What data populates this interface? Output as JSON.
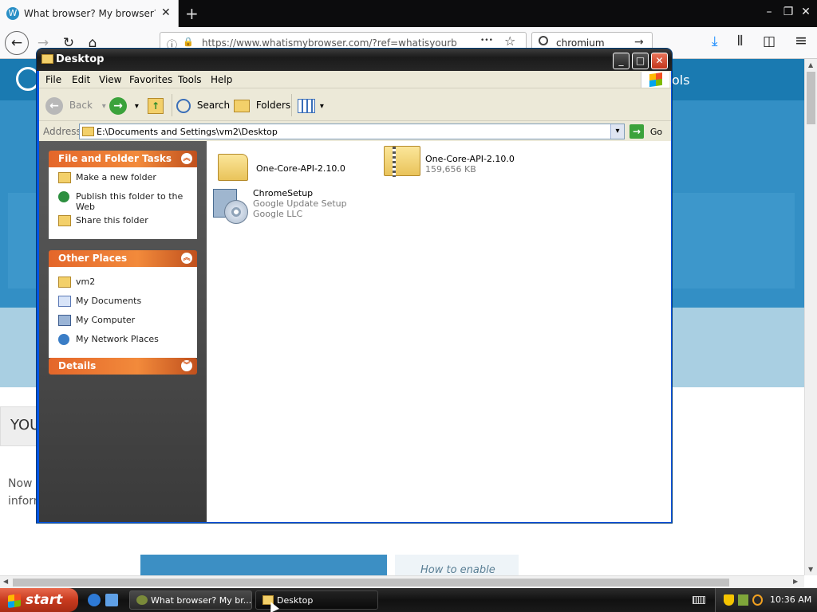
{
  "firefox": {
    "tab_title": "What browser? My browser? Is my",
    "tab_favicon": "W",
    "tab_close": "✕",
    "new_tab": "+",
    "window_buttons": {
      "minimize": "–",
      "restore": "❐",
      "close": "✕"
    },
    "nav": {
      "back": "←",
      "forward": "→",
      "reload": "↻",
      "home": "⌂"
    },
    "url": "https://www.whatismybrowser.com/?ref=whatisyourb",
    "url_icons": {
      "info": "ⓘ",
      "lock": "🔒",
      "more": "•••",
      "star": "☆"
    },
    "search_value": "chromium",
    "search_go": "→",
    "toolbar_icons": {
      "download": "⤓",
      "library": "⫴",
      "sidebar": "◫",
      "menu": "≡"
    },
    "colors": {
      "site_header": "#1a7ab1",
      "site_hero": "#338fc5"
    }
  },
  "website": {
    "tools_fragment": "ols",
    "you_fragment": "YOU",
    "now_fragment_1": "Now",
    "now_fragment_2": "inform",
    "howto_fragment": "How to enable"
  },
  "explorer": {
    "title": "Desktop",
    "caption_buttons": {
      "minimize": "_",
      "maximize": "□",
      "close": "✕"
    },
    "menu": [
      "File",
      "Edit",
      "View",
      "Favorites",
      "Tools",
      "Help"
    ],
    "toolbar": {
      "back_label": "Back",
      "back_icon": "←",
      "forward_icon": "→",
      "dropdown": "▾",
      "up_icon": "↑",
      "search_label": "Search",
      "folders_label": "Folders"
    },
    "address": {
      "label": "Address",
      "value": "E:\\Documents and Settings\\vm2\\Desktop",
      "dropdown": "▾",
      "go_label": "Go",
      "go_icon": "→"
    },
    "panels": {
      "file_tasks": {
        "title": "File and Folder Tasks",
        "chevron": "︽",
        "items": [
          "Make a new folder",
          "Publish this folder to the Web",
          "Share this folder"
        ]
      },
      "other_places": {
        "title": "Other Places",
        "chevron": "︽",
        "items": [
          "vm2",
          "My Documents",
          "My Computer",
          "My Network Places"
        ]
      },
      "details": {
        "title": "Details",
        "chevron": "︾"
      }
    },
    "files": [
      {
        "name": "One-Core-API-2.10.0",
        "type": "folder"
      },
      {
        "name": "One-Core-API-2.10.0",
        "size": "159,656 KB",
        "type": "zip"
      },
      {
        "name": "ChromeSetup",
        "line2": "Google Update Setup",
        "line3": "Google LLC",
        "type": "setup"
      }
    ]
  },
  "taskbar": {
    "start_label": "start",
    "buttons": [
      "What browser? My br...",
      "Desktop"
    ],
    "clock": "10:36 AM"
  }
}
